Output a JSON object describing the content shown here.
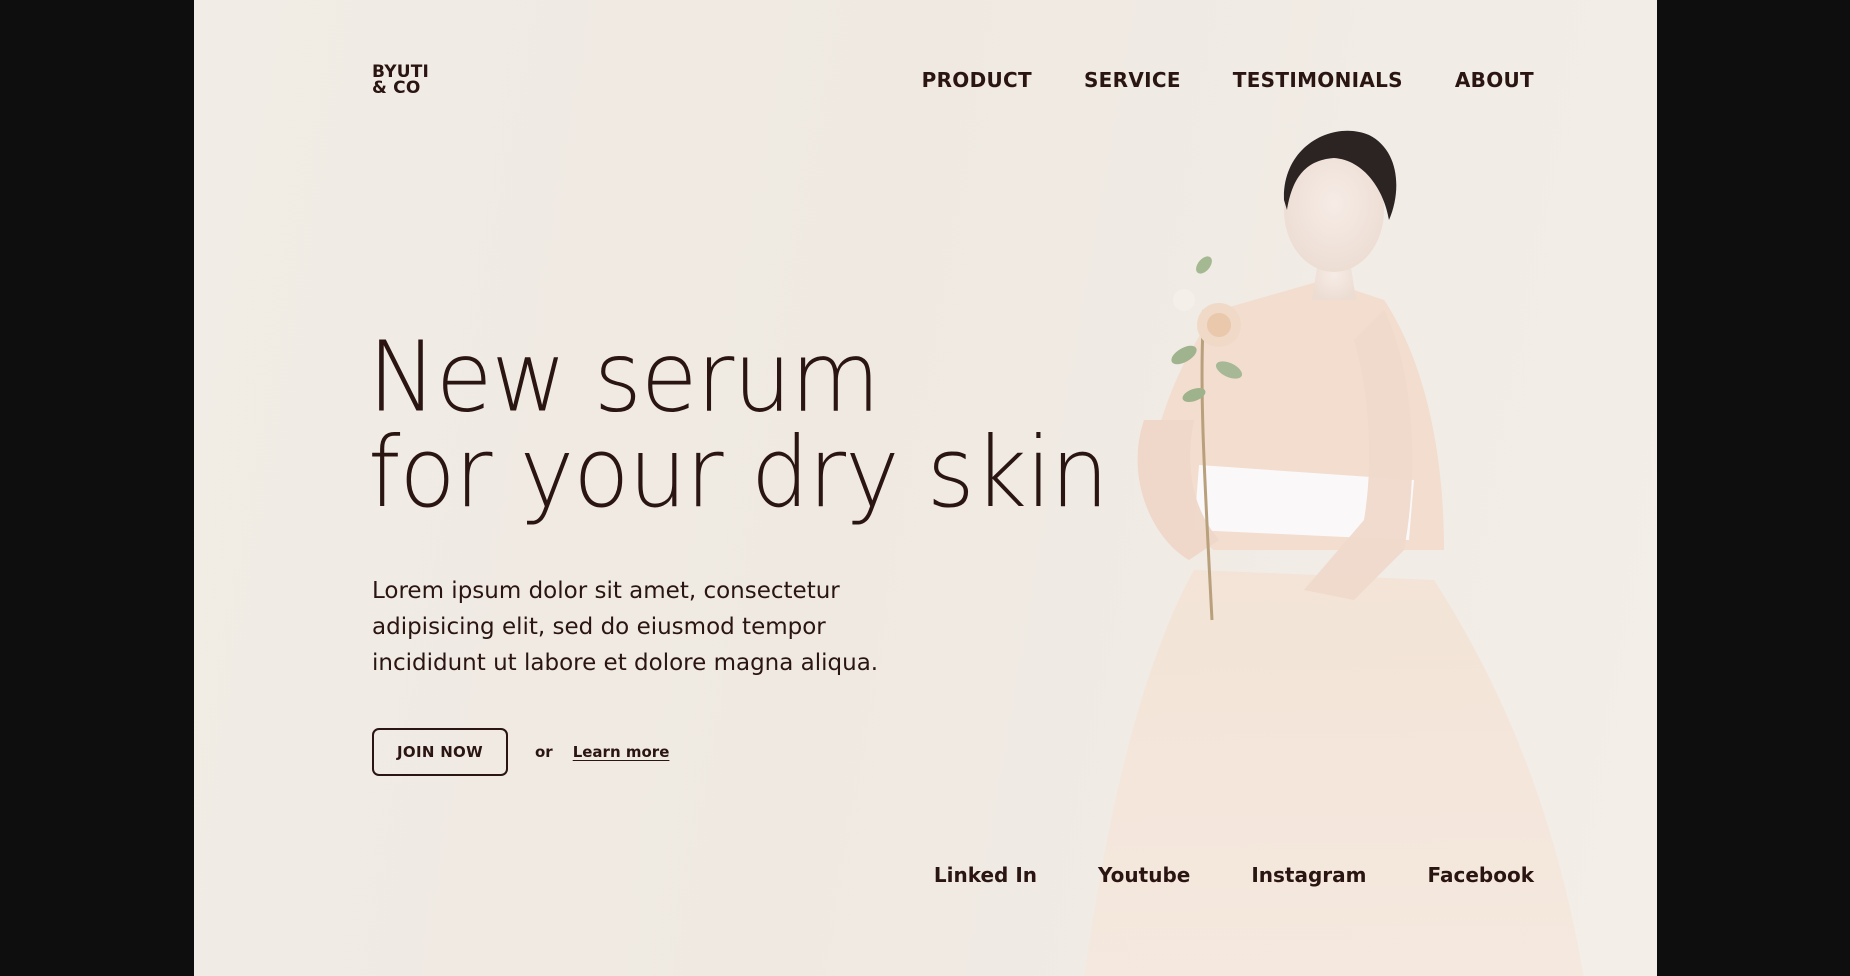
{
  "brand": {
    "line1": "BYUTI",
    "line2": "& CO"
  },
  "nav": {
    "items": [
      "PRODUCT",
      "SERVICE",
      "TESTIMONIALS",
      "ABOUT"
    ]
  },
  "hero": {
    "headline_line1": "New serum",
    "headline_line2": "for your dry skin",
    "body": "Lorem ipsum dolor sit amet, consectetur adipisicing elit, sed do eiusmod tempor incididunt ut labore et dolore magna aliqua.",
    "primary_cta": "JOIN NOW",
    "separator": "or",
    "secondary_cta": "Learn more"
  },
  "social": {
    "items": [
      "Linked In",
      "Youtube",
      "Instagram",
      "Facebook"
    ]
  },
  "colors": {
    "background": "#f0ebe4",
    "text": "#2a1512",
    "outer": "#0e0e0f",
    "dress": "#f2dfd1"
  }
}
